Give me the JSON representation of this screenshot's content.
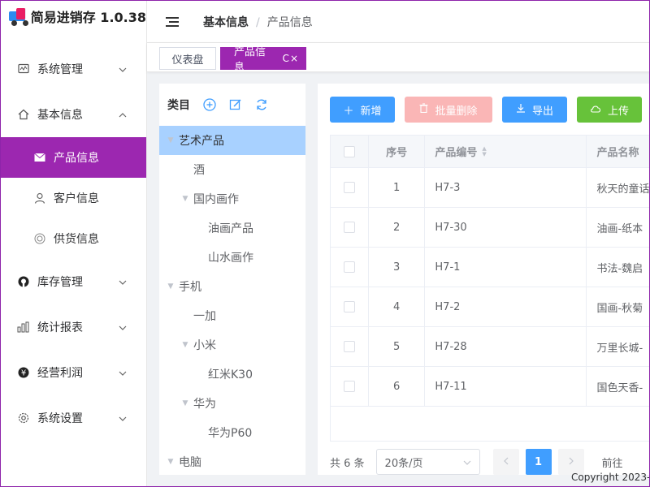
{
  "app": {
    "title": "简易进销存 1.0.38"
  },
  "sidebar": {
    "items": [
      {
        "label": "系统管理",
        "icon": "monitor-icon",
        "expanded": false
      },
      {
        "label": "基本信息",
        "icon": "home-icon",
        "expanded": true,
        "children": [
          {
            "label": "产品信息",
            "icon": "mail-icon",
            "active": true
          },
          {
            "label": "客户信息",
            "icon": "user-icon",
            "active": false
          },
          {
            "label": "供货信息",
            "icon": "target-icon",
            "active": false
          }
        ]
      },
      {
        "label": "库存管理",
        "icon": "github-icon",
        "expanded": false
      },
      {
        "label": "统计报表",
        "icon": "bar-chart-icon",
        "expanded": false
      },
      {
        "label": "经营利润",
        "icon": "yen-icon",
        "expanded": false
      },
      {
        "label": "系统设置",
        "icon": "gear-icon",
        "expanded": false
      }
    ]
  },
  "breadcrumb": {
    "parent": "基本信息",
    "separator": "/",
    "current": "产品信息"
  },
  "tabs": [
    {
      "label": "仪表盘",
      "active": false
    },
    {
      "label": "产品信息",
      "active": true
    }
  ],
  "tree": {
    "title": "类目",
    "nodes": [
      {
        "label": "艺术产品",
        "level": 0,
        "caret": true,
        "selected": true
      },
      {
        "label": "酒",
        "level": 1,
        "caret": false
      },
      {
        "label": "国内画作",
        "level": 1,
        "caret": true
      },
      {
        "label": "油画产品",
        "level": 2,
        "caret": false
      },
      {
        "label": "山水画作",
        "level": 2,
        "caret": false
      },
      {
        "label": "手机",
        "level": 0,
        "caret": true
      },
      {
        "label": "一加",
        "level": 1,
        "caret": false
      },
      {
        "label": "小米",
        "level": 1,
        "caret": true
      },
      {
        "label": "红米K30",
        "level": 2,
        "caret": false
      },
      {
        "label": "华为",
        "level": 1,
        "caret": true
      },
      {
        "label": "华为P60",
        "level": 2,
        "caret": false
      },
      {
        "label": "电脑",
        "level": 0,
        "caret": true
      }
    ]
  },
  "toolbar": {
    "add": "新增",
    "batch_delete": "批量删除",
    "export": "导出",
    "upload": "上传"
  },
  "table": {
    "headers": {
      "index": "序号",
      "code": "产品编号",
      "name": "产品名称"
    },
    "rows": [
      {
        "index": "1",
        "code": "H7-3",
        "name": "秋天的童话"
      },
      {
        "index": "2",
        "code": "H7-30",
        "name": "油画-纸本"
      },
      {
        "index": "3",
        "code": "H7-1",
        "name": "书法-魏启"
      },
      {
        "index": "4",
        "code": "H7-2",
        "name": "国画-秋菊"
      },
      {
        "index": "5",
        "code": "H7-28",
        "name": "万里长城-"
      },
      {
        "index": "6",
        "code": "H7-11",
        "name": "国色天香-"
      }
    ]
  },
  "pagination": {
    "total": "共 6 条",
    "page_size": "20条/页",
    "current": "1",
    "goto": "前往"
  },
  "footer": {
    "copyright": "Copyright 2023-"
  },
  "colors": {
    "accent": "#9c27b0",
    "primary": "#409eff",
    "success": "#67c23a",
    "danger_light": "#fab6b6",
    "tree_selected": "#a8d1ff"
  }
}
